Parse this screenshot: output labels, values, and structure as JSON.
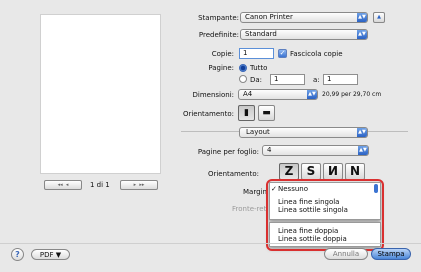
{
  "printer": {
    "label": "Stampante:",
    "value": "Canon Printer"
  },
  "presets": {
    "label": "Predefinite:",
    "value": "Standard"
  },
  "copies": {
    "label": "Copie:",
    "value": "1",
    "collate_label": "Fascicola copie"
  },
  "pages": {
    "label": "Pagine:",
    "all_label": "Tutto",
    "from_label": "Da:",
    "from_value": "1",
    "to_label": "a:",
    "to_value": "1"
  },
  "paper": {
    "label": "Dimensioni:",
    "value": "A4",
    "size_text": "20,99 per 29,70 cm"
  },
  "orientation": {
    "label": "Orientamento:"
  },
  "section": {
    "value": "Layout"
  },
  "pages_per_sheet": {
    "label": "Pagine per foglio:",
    "value": "4"
  },
  "layout_direction": {
    "label": "Orientamento:"
  },
  "border": {
    "label": "Margin",
    "options": [
      "Nessuno",
      "Linea fine singola",
      "Linea sottile singola",
      "Linea fine doppia",
      "Linea sottile doppia"
    ]
  },
  "two_sided": {
    "label": "Fronte-ret"
  },
  "preview": {
    "page_indicator": "1 di 1"
  },
  "footer": {
    "help": "?",
    "pdf": "PDF ▼",
    "cancel": "Annulla",
    "print": "Stampa"
  },
  "highlight_color": "#d93030"
}
